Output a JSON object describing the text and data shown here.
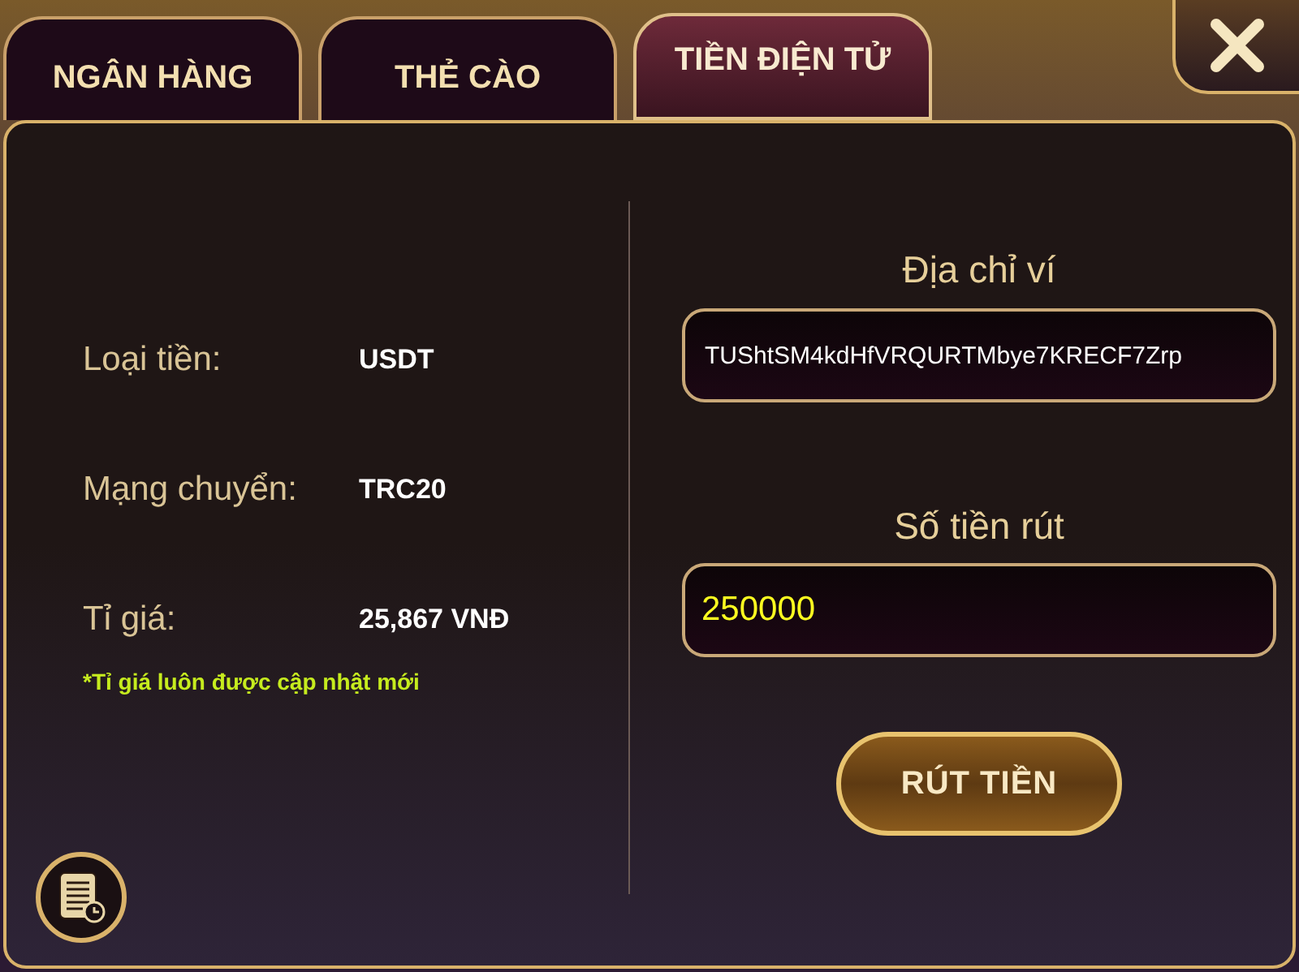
{
  "tabs": [
    {
      "label": "NGÂN HÀNG",
      "selected": false
    },
    {
      "label": "THẺ CÀO",
      "selected": false
    },
    {
      "label": "TIỀN ĐIỆN TỬ",
      "selected": true
    }
  ],
  "info": [
    {
      "label": "Loại tiền:",
      "value": "USDT"
    },
    {
      "label": "Mạng chuyển:",
      "value": "TRC20"
    },
    {
      "label": "Tỉ giá:",
      "value": "25,867 VNĐ"
    }
  ],
  "note": "*Tỉ giá luôn được cập nhật mới",
  "address": {
    "label": "Địa chỉ ví",
    "value": "TUShtSM4kdHfVRQURTMbye7KRECF7Zrp"
  },
  "amount": {
    "label": "Số tiền rút",
    "value": "250000"
  },
  "submit": "RÚT TIỀN"
}
